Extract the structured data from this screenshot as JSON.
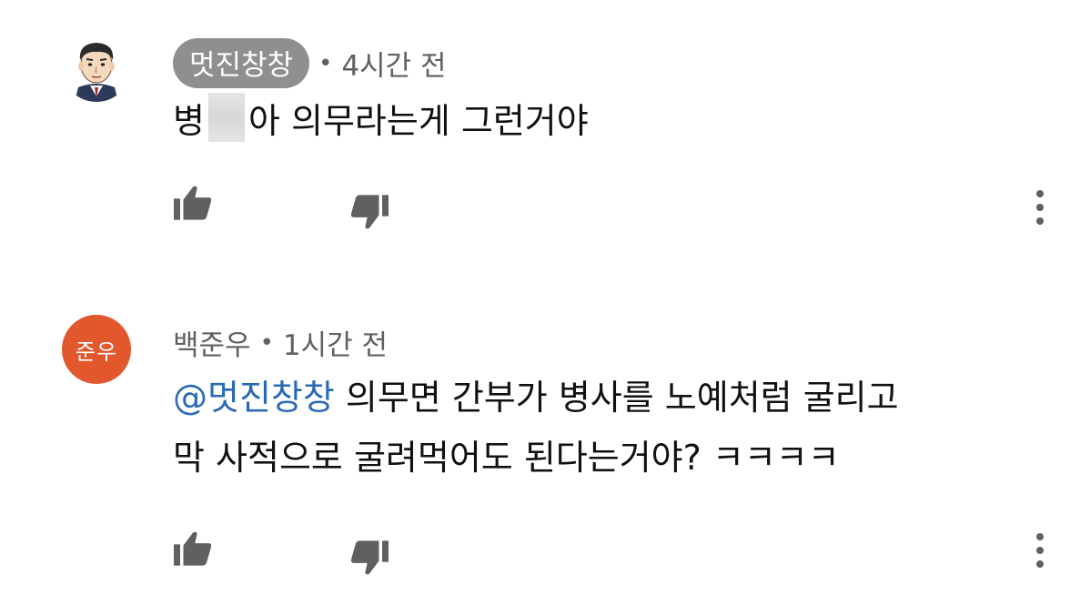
{
  "comments": [
    {
      "author": "멋진창창",
      "separator": "•",
      "time": "4시간 전",
      "text_before_redaction": "병",
      "text_after_redaction": "아 의무라는게 그런거야",
      "avatar_icon": "cartoon-man-suit-avatar"
    },
    {
      "author": "백준우",
      "separator": "•",
      "time": "1시간 전",
      "avatar_initials": "준우",
      "avatar_color": "#e2572c",
      "mention": "@멋진창창",
      "text_line1": " 의무면 간부가 병사를 노예처럼 굴리고",
      "text_line2": "막 사적으로 굴려먹어도 된다는거야? ㅋㅋㅋㅋ"
    }
  ],
  "icons": {
    "like": "thumbs-up-icon",
    "dislike": "thumbs-down-icon",
    "more": "more-vertical-icon"
  },
  "colors": {
    "author_chip": "#8f8f8f",
    "mention": "#2a6ab4",
    "icon": "#606060"
  }
}
